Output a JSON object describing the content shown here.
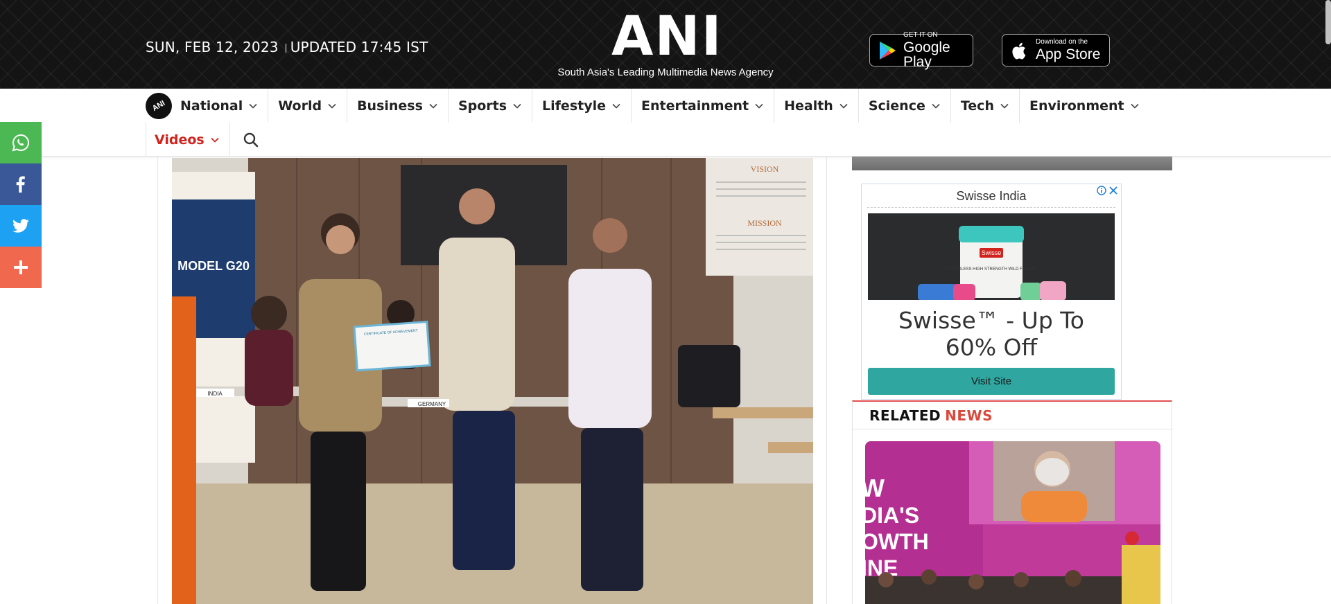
{
  "header": {
    "date": "SUN, FEB 12, 2023",
    "updated": "UPDATED 17:45 IST",
    "logo_text": "ANI",
    "tagline": "South Asia's Leading Multimedia News Agency",
    "google_play": {
      "small": "GET IT ON",
      "big": "Google Play"
    },
    "app_store": {
      "small": "Download on the",
      "big": "App Store"
    }
  },
  "nav": {
    "logo_text": "ANI",
    "items": [
      {
        "label": "National"
      },
      {
        "label": "World"
      },
      {
        "label": "Business"
      },
      {
        "label": "Sports"
      },
      {
        "label": "Lifestyle"
      },
      {
        "label": "Entertainment"
      },
      {
        "label": "Health"
      },
      {
        "label": "Science"
      },
      {
        "label": "Tech"
      },
      {
        "label": "Environment"
      }
    ],
    "videos_label": "Videos"
  },
  "social": [
    "whatsapp-icon",
    "facebook-icon",
    "twitter-icon",
    "plus-icon"
  ],
  "article_photo": {
    "vision_title": "VISION",
    "mission_title": "MISSION",
    "banner_text": "MODEL G20",
    "certificate_text": "CERTIFICATE OF ACHIEVEMENT",
    "placard_1": "INDIA",
    "placard_2": "GERMANY"
  },
  "ad": {
    "brand": "Swisse India",
    "product_brand": "Swisse",
    "product_text": "ODOURLESS HIGH STRENGTH WILD FISH OIL",
    "headline_line1": "Swisse™ - Up To",
    "headline_line2": "60% Off",
    "cta": "Visit Site"
  },
  "related": {
    "word1": "RELATED",
    "word2": "NEWS",
    "image_text_lines": [
      "W",
      "DIA'S",
      "OWTH",
      "INE"
    ]
  },
  "colors": {
    "accent_red": "#d0231c",
    "related_red": "#d94a3d",
    "whatsapp": "#4cb853",
    "facebook": "#3a5898",
    "twitter": "#1da1f2",
    "share_more": "#f0684e",
    "ad_button": "#2fa6a0"
  }
}
